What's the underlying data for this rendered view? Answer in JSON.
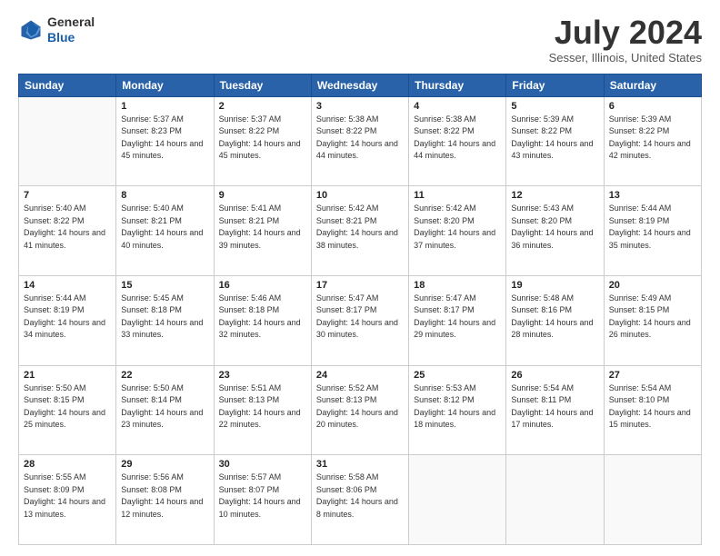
{
  "header": {
    "logo_general": "General",
    "logo_blue": "Blue",
    "month_title": "July 2024",
    "location": "Sesser, Illinois, United States"
  },
  "weekdays": [
    "Sunday",
    "Monday",
    "Tuesday",
    "Wednesday",
    "Thursday",
    "Friday",
    "Saturday"
  ],
  "weeks": [
    [
      {
        "day": "",
        "sunrise": "",
        "sunset": "",
        "daylight": ""
      },
      {
        "day": "1",
        "sunrise": "Sunrise: 5:37 AM",
        "sunset": "Sunset: 8:23 PM",
        "daylight": "Daylight: 14 hours and 45 minutes."
      },
      {
        "day": "2",
        "sunrise": "Sunrise: 5:37 AM",
        "sunset": "Sunset: 8:22 PM",
        "daylight": "Daylight: 14 hours and 45 minutes."
      },
      {
        "day": "3",
        "sunrise": "Sunrise: 5:38 AM",
        "sunset": "Sunset: 8:22 PM",
        "daylight": "Daylight: 14 hours and 44 minutes."
      },
      {
        "day": "4",
        "sunrise": "Sunrise: 5:38 AM",
        "sunset": "Sunset: 8:22 PM",
        "daylight": "Daylight: 14 hours and 44 minutes."
      },
      {
        "day": "5",
        "sunrise": "Sunrise: 5:39 AM",
        "sunset": "Sunset: 8:22 PM",
        "daylight": "Daylight: 14 hours and 43 minutes."
      },
      {
        "day": "6",
        "sunrise": "Sunrise: 5:39 AM",
        "sunset": "Sunset: 8:22 PM",
        "daylight": "Daylight: 14 hours and 42 minutes."
      }
    ],
    [
      {
        "day": "7",
        "sunrise": "Sunrise: 5:40 AM",
        "sunset": "Sunset: 8:22 PM",
        "daylight": "Daylight: 14 hours and 41 minutes."
      },
      {
        "day": "8",
        "sunrise": "Sunrise: 5:40 AM",
        "sunset": "Sunset: 8:21 PM",
        "daylight": "Daylight: 14 hours and 40 minutes."
      },
      {
        "day": "9",
        "sunrise": "Sunrise: 5:41 AM",
        "sunset": "Sunset: 8:21 PM",
        "daylight": "Daylight: 14 hours and 39 minutes."
      },
      {
        "day": "10",
        "sunrise": "Sunrise: 5:42 AM",
        "sunset": "Sunset: 8:21 PM",
        "daylight": "Daylight: 14 hours and 38 minutes."
      },
      {
        "day": "11",
        "sunrise": "Sunrise: 5:42 AM",
        "sunset": "Sunset: 8:20 PM",
        "daylight": "Daylight: 14 hours and 37 minutes."
      },
      {
        "day": "12",
        "sunrise": "Sunrise: 5:43 AM",
        "sunset": "Sunset: 8:20 PM",
        "daylight": "Daylight: 14 hours and 36 minutes."
      },
      {
        "day": "13",
        "sunrise": "Sunrise: 5:44 AM",
        "sunset": "Sunset: 8:19 PM",
        "daylight": "Daylight: 14 hours and 35 minutes."
      }
    ],
    [
      {
        "day": "14",
        "sunrise": "Sunrise: 5:44 AM",
        "sunset": "Sunset: 8:19 PM",
        "daylight": "Daylight: 14 hours and 34 minutes."
      },
      {
        "day": "15",
        "sunrise": "Sunrise: 5:45 AM",
        "sunset": "Sunset: 8:18 PM",
        "daylight": "Daylight: 14 hours and 33 minutes."
      },
      {
        "day": "16",
        "sunrise": "Sunrise: 5:46 AM",
        "sunset": "Sunset: 8:18 PM",
        "daylight": "Daylight: 14 hours and 32 minutes."
      },
      {
        "day": "17",
        "sunrise": "Sunrise: 5:47 AM",
        "sunset": "Sunset: 8:17 PM",
        "daylight": "Daylight: 14 hours and 30 minutes."
      },
      {
        "day": "18",
        "sunrise": "Sunrise: 5:47 AM",
        "sunset": "Sunset: 8:17 PM",
        "daylight": "Daylight: 14 hours and 29 minutes."
      },
      {
        "day": "19",
        "sunrise": "Sunrise: 5:48 AM",
        "sunset": "Sunset: 8:16 PM",
        "daylight": "Daylight: 14 hours and 28 minutes."
      },
      {
        "day": "20",
        "sunrise": "Sunrise: 5:49 AM",
        "sunset": "Sunset: 8:15 PM",
        "daylight": "Daylight: 14 hours and 26 minutes."
      }
    ],
    [
      {
        "day": "21",
        "sunrise": "Sunrise: 5:50 AM",
        "sunset": "Sunset: 8:15 PM",
        "daylight": "Daylight: 14 hours and 25 minutes."
      },
      {
        "day": "22",
        "sunrise": "Sunrise: 5:50 AM",
        "sunset": "Sunset: 8:14 PM",
        "daylight": "Daylight: 14 hours and 23 minutes."
      },
      {
        "day": "23",
        "sunrise": "Sunrise: 5:51 AM",
        "sunset": "Sunset: 8:13 PM",
        "daylight": "Daylight: 14 hours and 22 minutes."
      },
      {
        "day": "24",
        "sunrise": "Sunrise: 5:52 AM",
        "sunset": "Sunset: 8:13 PM",
        "daylight": "Daylight: 14 hours and 20 minutes."
      },
      {
        "day": "25",
        "sunrise": "Sunrise: 5:53 AM",
        "sunset": "Sunset: 8:12 PM",
        "daylight": "Daylight: 14 hours and 18 minutes."
      },
      {
        "day": "26",
        "sunrise": "Sunrise: 5:54 AM",
        "sunset": "Sunset: 8:11 PM",
        "daylight": "Daylight: 14 hours and 17 minutes."
      },
      {
        "day": "27",
        "sunrise": "Sunrise: 5:54 AM",
        "sunset": "Sunset: 8:10 PM",
        "daylight": "Daylight: 14 hours and 15 minutes."
      }
    ],
    [
      {
        "day": "28",
        "sunrise": "Sunrise: 5:55 AM",
        "sunset": "Sunset: 8:09 PM",
        "daylight": "Daylight: 14 hours and 13 minutes."
      },
      {
        "day": "29",
        "sunrise": "Sunrise: 5:56 AM",
        "sunset": "Sunset: 8:08 PM",
        "daylight": "Daylight: 14 hours and 12 minutes."
      },
      {
        "day": "30",
        "sunrise": "Sunrise: 5:57 AM",
        "sunset": "Sunset: 8:07 PM",
        "daylight": "Daylight: 14 hours and 10 minutes."
      },
      {
        "day": "31",
        "sunrise": "Sunrise: 5:58 AM",
        "sunset": "Sunset: 8:06 PM",
        "daylight": "Daylight: 14 hours and 8 minutes."
      },
      {
        "day": "",
        "sunrise": "",
        "sunset": "",
        "daylight": ""
      },
      {
        "day": "",
        "sunrise": "",
        "sunset": "",
        "daylight": ""
      },
      {
        "day": "",
        "sunrise": "",
        "sunset": "",
        "daylight": ""
      }
    ]
  ]
}
